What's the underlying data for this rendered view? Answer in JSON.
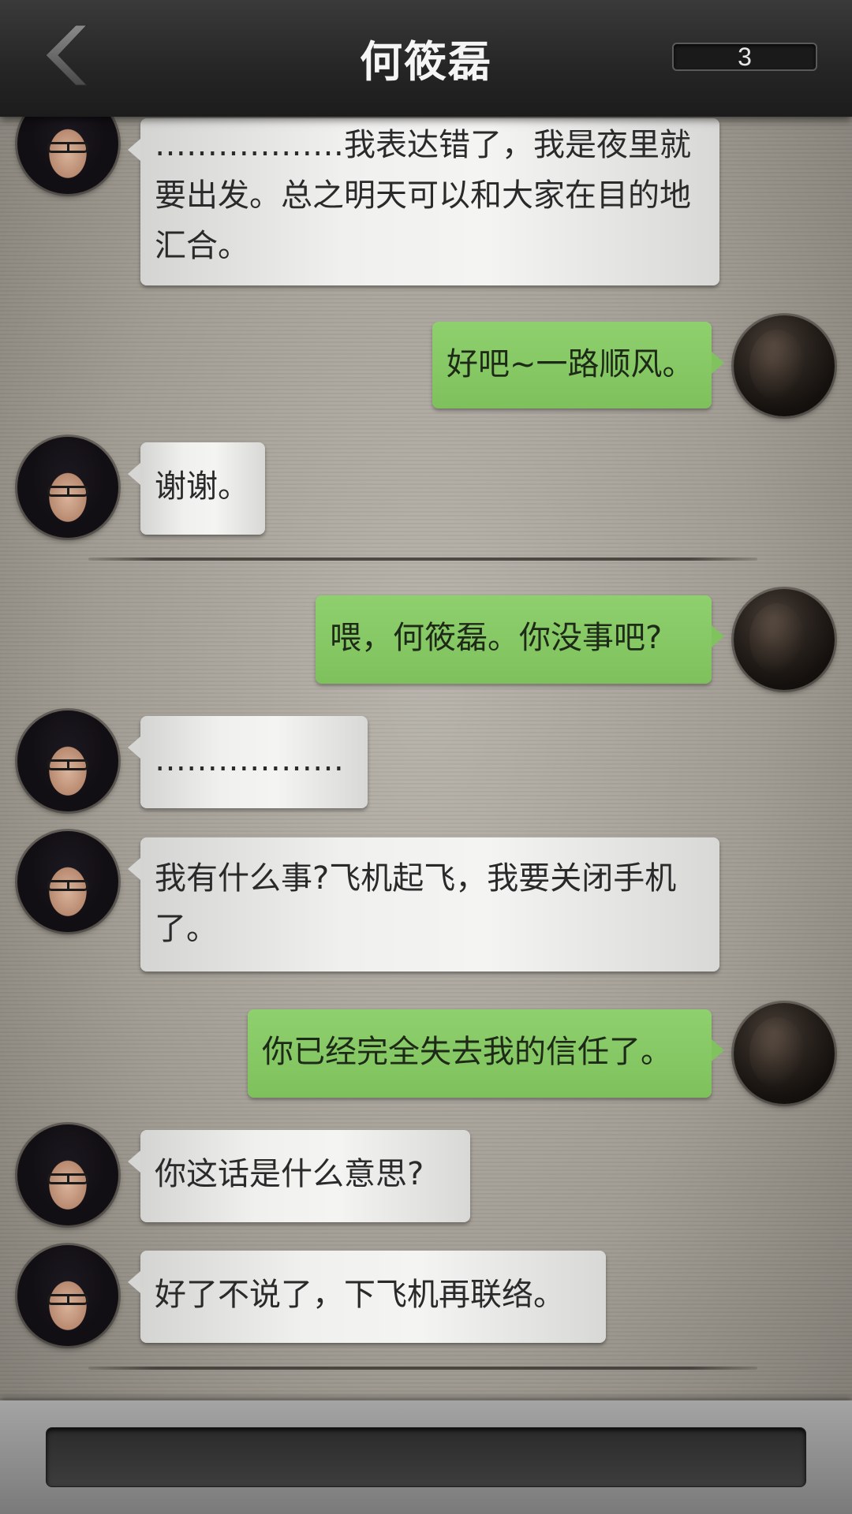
{
  "header": {
    "title": "何筱磊",
    "counter": "3"
  },
  "messages": [
    {
      "side": "left",
      "text": "………………我表达错了，我是夜里就要出发。总之明天可以和大家在目的地汇合。"
    },
    {
      "side": "right",
      "text": "好吧~一路顺风。"
    },
    {
      "side": "left",
      "text": "谢谢。"
    },
    {
      "side": "right",
      "text": "喂，何筱磊。你没事吧?"
    },
    {
      "side": "left",
      "text": "………………"
    },
    {
      "side": "left",
      "text": "我有什么事?飞机起飞，我要关闭手机了。"
    },
    {
      "side": "right",
      "text": "你已经完全失去我的信任了。"
    },
    {
      "side": "left",
      "text": "你这话是什么意思?"
    },
    {
      "side": "left",
      "text": "好了不说了，下飞机再联络。"
    }
  ],
  "icons": {
    "back": "chevron-left-icon"
  },
  "colors": {
    "header_bg": "#252525",
    "self_bubble": "#7ec15c",
    "friend_bubble": "#f0f0ee"
  }
}
